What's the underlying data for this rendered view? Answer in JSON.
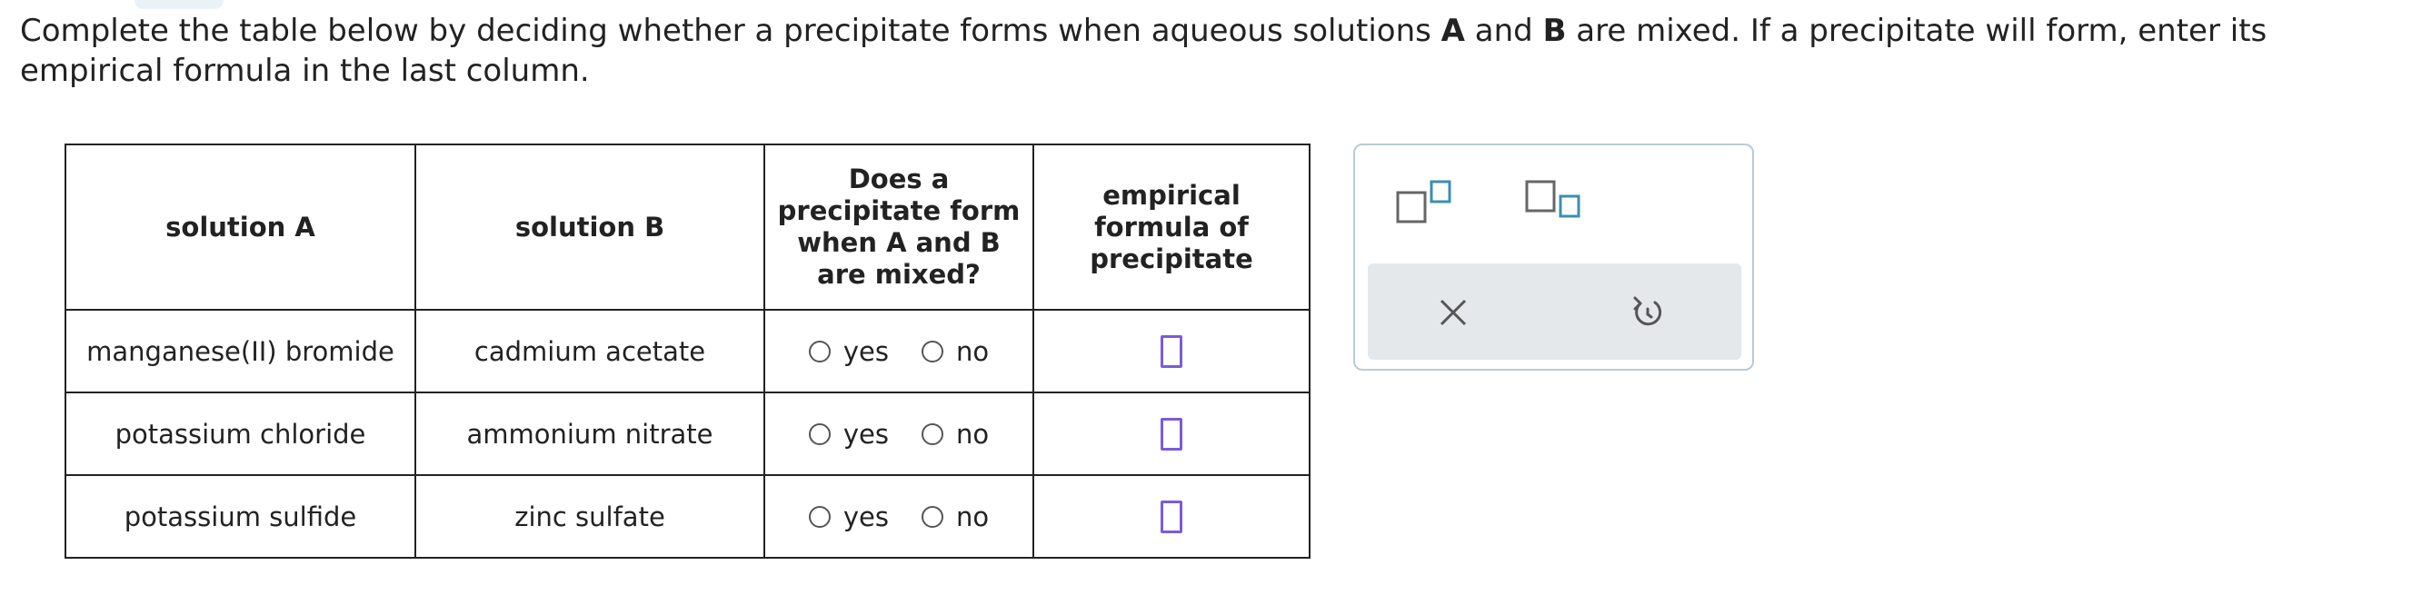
{
  "instructions": {
    "part1": "Complete the table below by deciding whether a precipitate forms when aqueous solutions ",
    "a": "A",
    "part2": " and ",
    "b": "B",
    "part3": " are mixed. If a precipitate will form, enter its empirical formula in the last column."
  },
  "table": {
    "headers": {
      "solution_a": "solution A",
      "solution_b": "solution B",
      "precipitate_question": "Does a precipitate form when A and B are mixed?",
      "formula": "empirical formula of precipitate"
    },
    "rows": [
      {
        "solution_a": "manganese(II) bromide",
        "solution_b": "cadmium acetate",
        "yes": "yes",
        "no": "no"
      },
      {
        "solution_a": "potassium chloride",
        "solution_b": "ammonium nitrate",
        "yes": "yes",
        "no": "no"
      },
      {
        "solution_a": "potassium sulfide",
        "solution_b": "zinc sulfate",
        "yes": "yes",
        "no": "no"
      }
    ]
  },
  "tools": {
    "superscript_icon": "superscript-box-icon",
    "subscript_icon": "subscript-box-icon",
    "clear_icon": "x-icon",
    "undo_icon": "undo-icon",
    "accent_color": "#7b5bd9",
    "tool_color": "#3b8fb0"
  }
}
